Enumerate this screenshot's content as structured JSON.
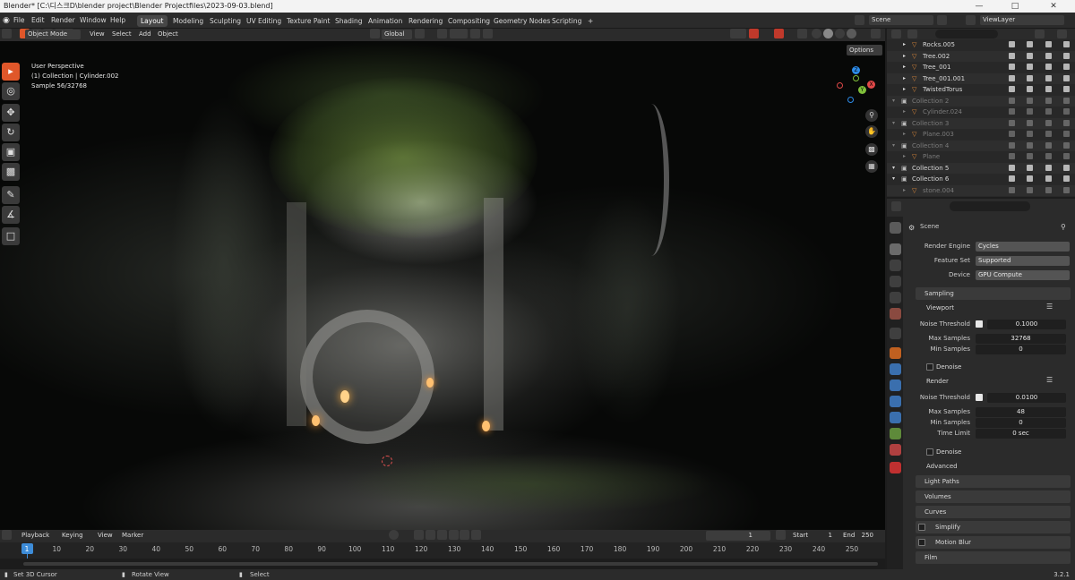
{
  "window": {
    "title": "Blender* [C:\\디스크D\\blender project\\Blender Projectfiles\\2023-09-03.blend]",
    "minimize": "—",
    "maximize": "□",
    "close": "✕"
  },
  "menu": {
    "items": [
      "File",
      "Edit",
      "Render",
      "Window",
      "Help"
    ]
  },
  "workspaces": [
    "Layout",
    "Modeling",
    "Sculpting",
    "UV Editing",
    "Texture Paint",
    "Shading",
    "Animation",
    "Rendering",
    "Compositing",
    "Geometry Nodes",
    "Scripting"
  ],
  "workspace_add": "+",
  "scene_selector": "Scene",
  "viewlayer_selector": "ViewLayer",
  "viewport_header": {
    "mode": "Object Mode",
    "menus": [
      "View",
      "Select",
      "Add",
      "Object"
    ],
    "orientation": "Global",
    "options": "Options"
  },
  "viewport_info": {
    "line1": "User Perspective",
    "line2": "(1) Collection | Cylinder.002",
    "line3": "Sample 56/32768"
  },
  "gizmo": {
    "x": "X",
    "y": "Y",
    "z": "Z"
  },
  "timeline": {
    "playback": "Playback",
    "keying": "Keying",
    "view": "View",
    "marker": "Marker",
    "current_frame": "1",
    "start_label": "Start",
    "start": "1",
    "end_label": "End",
    "end": "250",
    "ticks": [
      "1",
      "10",
      "20",
      "30",
      "40",
      "50",
      "60",
      "70",
      "80",
      "90",
      "100",
      "110",
      "120",
      "130",
      "140",
      "150",
      "160",
      "170",
      "180",
      "190",
      "200",
      "210",
      "220",
      "230",
      "240",
      "250"
    ]
  },
  "statusbar": {
    "left": "Set 3D Cursor",
    "middle": "Rotate View",
    "right": "Select",
    "version": "3.2.1"
  },
  "outliner": {
    "rows": [
      {
        "name": "Rocks.005",
        "dim": false
      },
      {
        "name": "Tree.002",
        "dim": false
      },
      {
        "name": "Tree_001",
        "dim": false
      },
      {
        "name": "Tree_001.001",
        "dim": false
      },
      {
        "name": "TwistedTorus",
        "dim": false
      },
      {
        "name": "Collection 2",
        "dim": true
      },
      {
        "name": "Cylinder.024",
        "dim": true
      },
      {
        "name": "Collection 3",
        "dim": true
      },
      {
        "name": "Plane.003",
        "dim": true
      },
      {
        "name": "Collection 4",
        "dim": true
      },
      {
        "name": "Plane",
        "dim": true
      },
      {
        "name": "Collection 5",
        "dim": false
      },
      {
        "name": "Collection 6",
        "dim": false
      },
      {
        "name": "stone.004",
        "dim": true
      }
    ]
  },
  "properties": {
    "context": "Scene",
    "render_engine_label": "Render Engine",
    "render_engine": "Cycles",
    "feature_set_label": "Feature Set",
    "feature_set": "Supported",
    "device_label": "Device",
    "device": "GPU Compute",
    "sampling": "Sampling",
    "viewport": "Viewport",
    "vp_noise_label": "Noise Threshold",
    "vp_noise": "0.1000",
    "vp_max_label": "Max Samples",
    "vp_max": "32768",
    "vp_min_label": "Min Samples",
    "vp_min": "0",
    "denoise": "Denoise",
    "render": "Render",
    "r_noise_label": "Noise Threshold",
    "r_noise": "0.0100",
    "r_max_label": "Max Samples",
    "r_max": "48",
    "r_min_label": "Min Samples",
    "r_min": "0",
    "time_limit_label": "Time Limit",
    "time_limit": "0 sec",
    "denoise2": "Denoise",
    "advanced": "Advanced",
    "light_paths": "Light Paths",
    "volumes": "Volumes",
    "curves": "Curves",
    "simplify": "Simplify",
    "motion_blur": "Motion Blur",
    "film": "Film"
  }
}
